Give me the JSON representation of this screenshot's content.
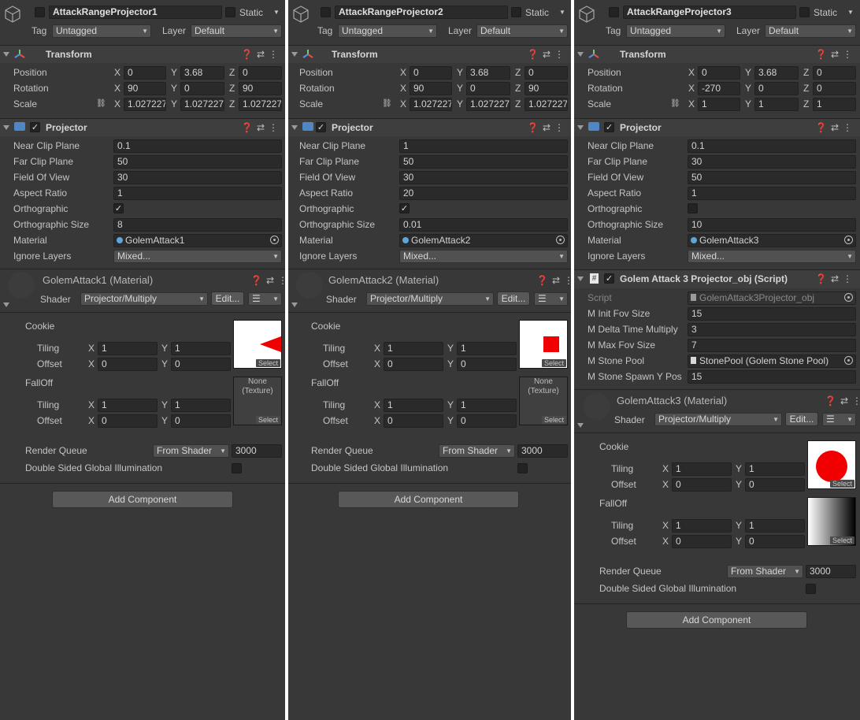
{
  "common": {
    "static_label": "Static",
    "tag_label": "Tag",
    "tag_value": "Untagged",
    "layer_label": "Layer",
    "layer_value": "Default",
    "transform_title": "Transform",
    "position_label": "Position",
    "rotation_label": "Rotation",
    "scale_label": "Scale",
    "x": "X",
    "y": "Y",
    "z": "Z",
    "projector_title": "Projector",
    "near_clip_label": "Near Clip Plane",
    "far_clip_label": "Far Clip Plane",
    "fov_label": "Field Of View",
    "aspect_label": "Aspect Ratio",
    "ortho_label": "Orthographic",
    "ortho_size_label": "Orthographic Size",
    "material_label": "Material",
    "ignore_layers_label": "Ignore Layers",
    "ignore_layers_value": "Mixed...",
    "shader_label": "Shader",
    "shader_value": "Projector/Multiply",
    "edit_label": "Edit...",
    "cookie_label": "Cookie",
    "falloff_label": "FallOff",
    "tiling_label": "Tiling",
    "offset_label": "Offset",
    "render_queue_label": "Render Queue",
    "render_queue_mode": "From Shader",
    "render_queue_value": "3000",
    "double_sided_label": "Double Sided Global Illumination",
    "add_component_label": "Add Component",
    "select_label": "Select",
    "none_texture_label": "None\n(Texture)",
    "tiling_x": "1",
    "tiling_y": "1",
    "offset_x": "0",
    "offset_y": "0"
  },
  "panels": [
    {
      "name": "AttackRangeProjector1",
      "position": [
        "0",
        "3.68",
        "0"
      ],
      "rotation": [
        "90",
        "0",
        "90"
      ],
      "scale": [
        "1.027227",
        "1.027227",
        "1.027227"
      ],
      "near_clip": "0.1",
      "far_clip": "50",
      "fov": "30",
      "aspect": "1",
      "orthographic": true,
      "ortho_size": "8",
      "material": "GolemAttack1",
      "material_header": "GolemAttack1 (Material)"
    },
    {
      "name": "AttackRangeProjector2",
      "position": [
        "0",
        "3.68",
        "0"
      ],
      "rotation": [
        "90",
        "0",
        "90"
      ],
      "scale": [
        "1.027227",
        "1.027227",
        "1.027227"
      ],
      "near_clip": "1",
      "far_clip": "50",
      "fov": "30",
      "aspect": "20",
      "orthographic": true,
      "ortho_size": "0.01",
      "material": "GolemAttack2",
      "material_header": "GolemAttack2 (Material)"
    },
    {
      "name": "AttackRangeProjector3",
      "position": [
        "0",
        "3.68",
        "0"
      ],
      "rotation": [
        "-270",
        "0",
        "0"
      ],
      "scale": [
        "1",
        "1",
        "1"
      ],
      "near_clip": "0.1",
      "far_clip": "30",
      "fov": "50",
      "aspect": "1",
      "orthographic": false,
      "ortho_size": "10",
      "material": "GolemAttack3",
      "material_header": "GolemAttack3 (Material)",
      "script": {
        "title": "Golem Attack 3 Projector_obj (Script)",
        "script_label": "Script",
        "script_value": "GolemAttack3Projector_obj",
        "init_fov_label": "M Init Fov Size",
        "init_fov": "15",
        "delta_label": "M Delta Time Multiply",
        "delta": "3",
        "max_fov_label": "M Max Fov Size",
        "max_fov": "7",
        "stone_pool_label": "M Stone Pool",
        "stone_pool": "StonePool (Golem Stone Pool)",
        "stone_y_label": "M Stone Spawn Y Pos",
        "stone_y": "15"
      }
    }
  ]
}
